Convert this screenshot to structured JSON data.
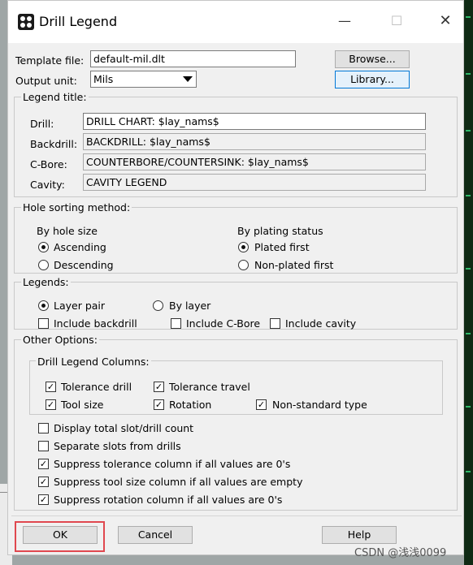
{
  "window": {
    "title": "Drill Legend"
  },
  "template": {
    "label": "Template file:",
    "value": "default-mil.dlt",
    "browse_button": "Browse..."
  },
  "output_unit": {
    "label": "Output unit:",
    "value": "Mils",
    "library_button": "Library..."
  },
  "legend_title": {
    "group_label": "Legend title:",
    "drill": {
      "label": "Drill:",
      "value": "DRILL CHART: $lay_nams$"
    },
    "backdrill": {
      "label": "Backdrill:",
      "value": "BACKDRILL: $lay_nams$"
    },
    "cbore": {
      "label": "C-Bore:",
      "value": "COUNTERBORE/COUNTERSINK: $lay_nams$"
    },
    "cavity": {
      "label": "Cavity:",
      "value": "CAVITY LEGEND"
    }
  },
  "hole_sorting": {
    "group_label": "Hole sorting method:",
    "by_size": {
      "label": "By hole size",
      "ascending": "Ascending",
      "descending": "Descending",
      "selected": "Ascending"
    },
    "by_plating": {
      "label": "By plating status",
      "plated_first": "Plated first",
      "nonplated_first": "Non-plated first",
      "selected": "Plated first"
    }
  },
  "legends": {
    "group_label": "Legends:",
    "layer_pair": "Layer pair",
    "by_layer": "By layer",
    "selected": "Layer pair",
    "include_backdrill": {
      "label": "Include backdrill",
      "checked": false
    },
    "include_cbore": {
      "label": "Include C-Bore",
      "checked": false
    },
    "include_cavity": {
      "label": "Include cavity",
      "checked": false
    }
  },
  "other_options": {
    "group_label": "Other Options:",
    "columns": {
      "group_label": "Drill Legend Columns:",
      "tolerance_drill": {
        "label": "Tolerance drill",
        "checked": true
      },
      "tolerance_travel": {
        "label": "Tolerance travel",
        "checked": true
      },
      "tool_size": {
        "label": "Tool size",
        "checked": true
      },
      "rotation": {
        "label": "Rotation",
        "checked": true
      },
      "nonstandard_type": {
        "label": "Non-standard type",
        "checked": true
      }
    },
    "display_total": {
      "label": "Display total slot/drill count",
      "checked": false
    },
    "separate_slots": {
      "label": "Separate slots from drills",
      "checked": false
    },
    "suppress_tolerance": {
      "label": "Suppress tolerance column if all values are 0's",
      "checked": true
    },
    "suppress_tool_size": {
      "label": "Suppress tool size column if all values are empty",
      "checked": true
    },
    "suppress_rotation": {
      "label": "Suppress rotation column if all values are 0's",
      "checked": true
    }
  },
  "buttons": {
    "ok": "OK",
    "cancel": "Cancel",
    "help": "Help"
  },
  "watermark": "CSDN @浅浅0099",
  "colors": {
    "highlight": "#e0484f",
    "focus_border": "#0078d7",
    "dialog_bg": "#f0f0f0"
  }
}
